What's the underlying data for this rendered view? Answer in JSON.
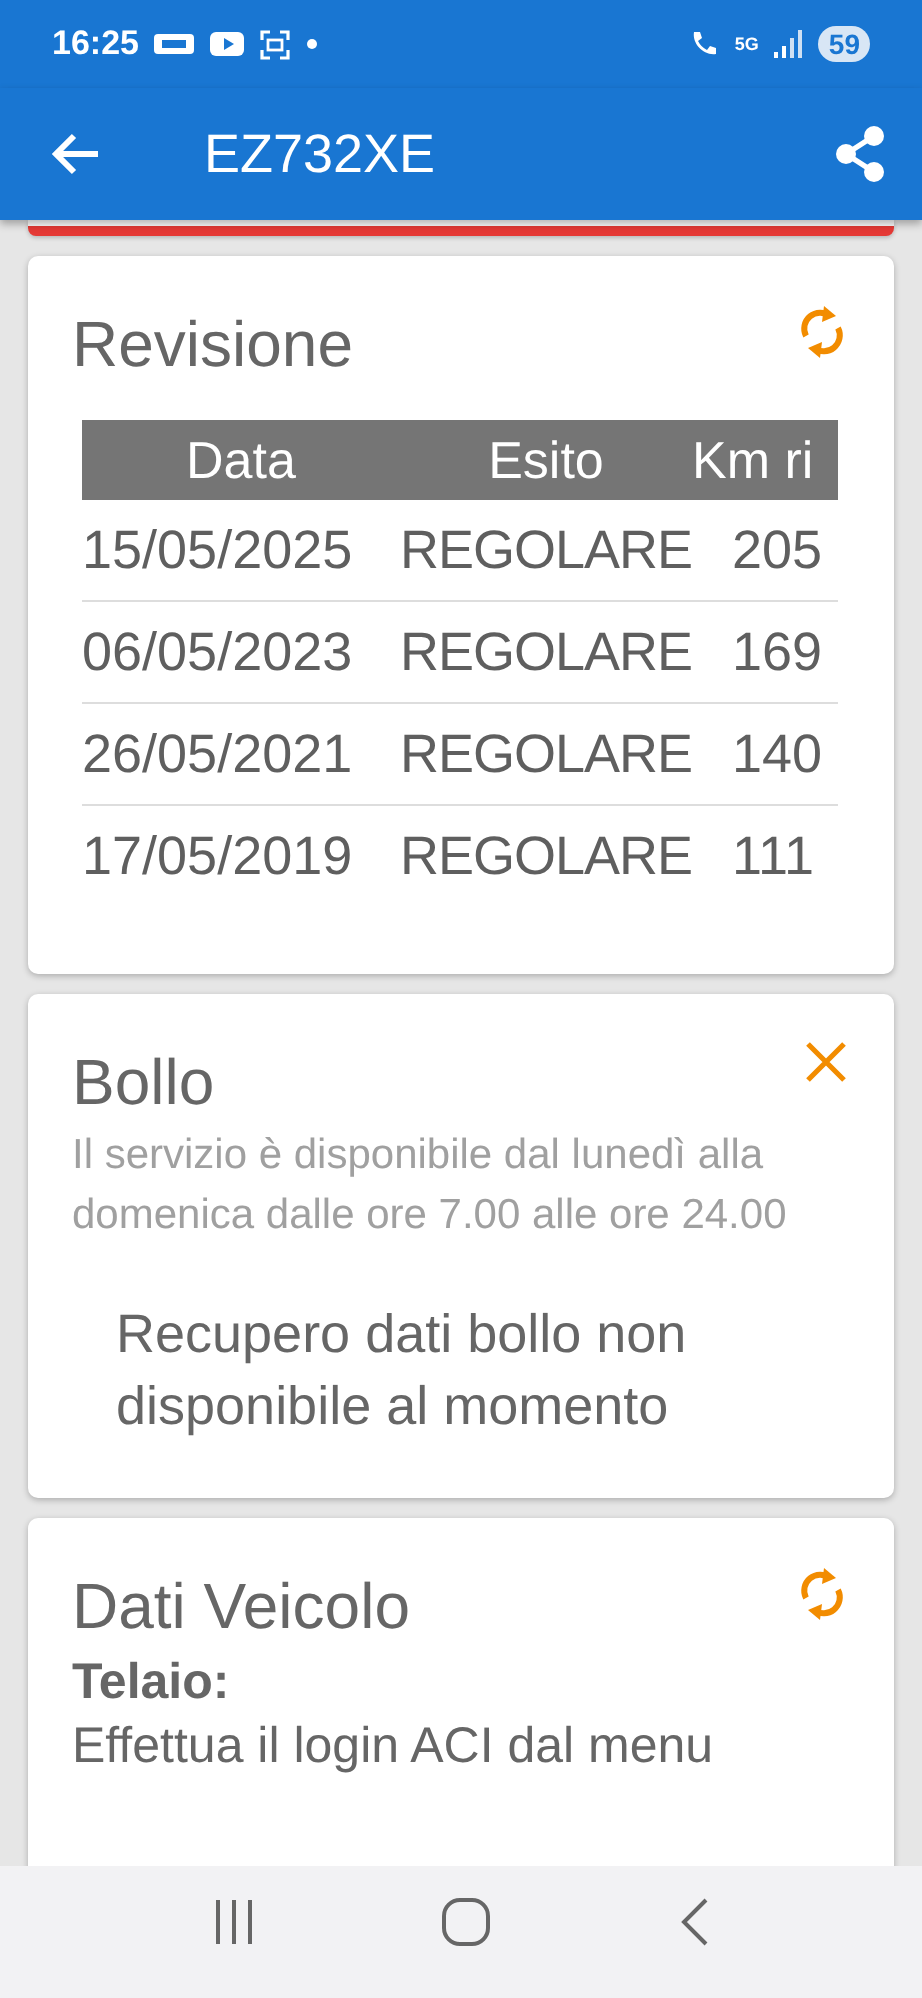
{
  "status_bar": {
    "time": "16:25",
    "network": "5G",
    "battery": "59"
  },
  "app_bar": {
    "title": "EZ732XE"
  },
  "cards": [
    {
      "kind": "table",
      "title": "Revisione",
      "action": {
        "kind": "refresh"
      },
      "columns": [
        "Data",
        "Esito",
        "Km ri"
      ],
      "rows": [
        [
          "15/05/2025",
          "REGOLARE",
          "205"
        ],
        [
          "06/05/2023",
          "REGOLARE",
          "169"
        ],
        [
          "26/05/2021",
          "REGOLARE",
          "140"
        ],
        [
          "17/05/2019",
          "REGOLARE",
          "111"
        ]
      ]
    },
    {
      "kind": "message",
      "title": "Bollo",
      "action": {
        "kind": "close"
      },
      "note": "Il servizio è disponibile dal lunedì alla domenica dalle ore 7.00 alle ore 24.00",
      "message": "Recupero dati bollo non disponibile al momento"
    },
    {
      "kind": "fields",
      "title": "Dati Veicolo",
      "action": {
        "kind": "refresh"
      },
      "fields": [
        {
          "label": "Telaio:",
          "value": "Effettua il login ACI dal menu"
        }
      ]
    }
  ]
}
